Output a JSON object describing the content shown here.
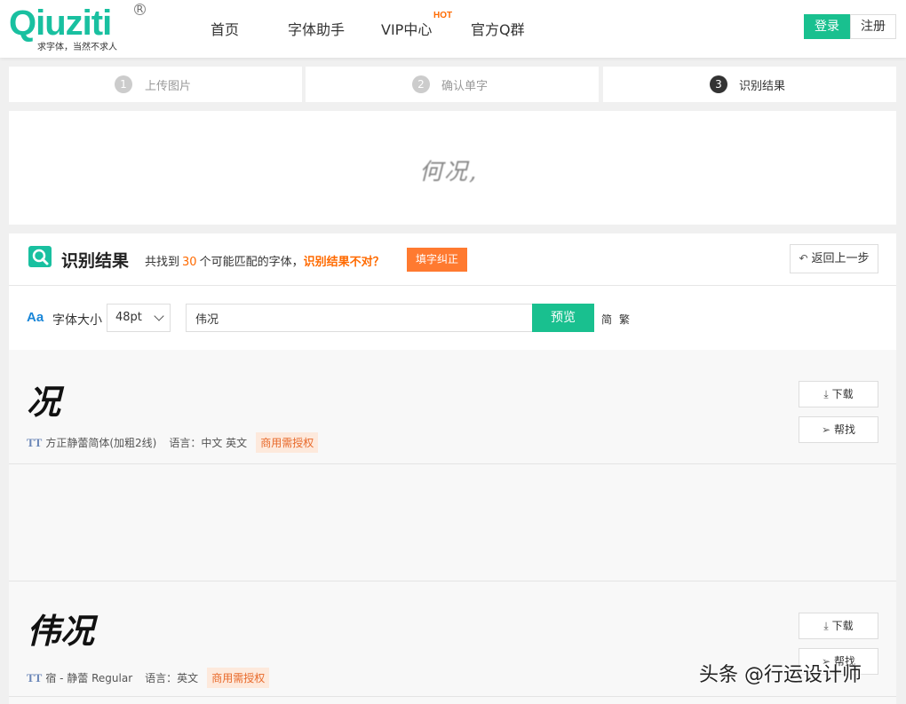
{
  "header": {
    "logo_text": "Qiuziti",
    "logo_registered": "R",
    "logo_slogan": "求字体，当然不求人",
    "nav": [
      "首页",
      "字体助手",
      "VIP中心",
      "官方Q群"
    ],
    "hot_badge": "HOT",
    "login_label": "登录",
    "register_label": "注册",
    "brand_color": "#19c08f"
  },
  "steps": [
    {
      "num": "1",
      "label": "上传图片"
    },
    {
      "num": "2",
      "label": "确认单字"
    },
    {
      "num": "3",
      "label": "识别结果"
    }
  ],
  "preview": {
    "text": "何况,"
  },
  "result": {
    "title": "识别结果",
    "desc_prefix": "共找到",
    "count": "30",
    "desc_suffix": "个可能匹配的字体，",
    "wrong_prompt": "识别结果不对？",
    "correct_button": "填字纠正",
    "back_button": "返回上一步",
    "accent_color": "#ff6a00"
  },
  "controls": {
    "size_icon": "Aa",
    "size_label": "字体大小",
    "size_value": "48pt",
    "text_value": "伟况",
    "preview_button": "预览",
    "simplified": "简",
    "traditional": "繁"
  },
  "fonts": [
    {
      "sample": "况",
      "name": "方正静蕾简体(加粗2线)",
      "language_label": "语言：",
      "languages": "中文 英文",
      "license": "商用需授权",
      "download": "下载",
      "help": "帮找"
    },
    {
      "sample": "伟况",
      "name": "宿 - 静蕾 Regular",
      "language_label": "语言：",
      "languages": "英文",
      "license": "商用需授权",
      "download": "下载",
      "help": "帮找"
    }
  ],
  "watermark": "头条 @行运设计师"
}
